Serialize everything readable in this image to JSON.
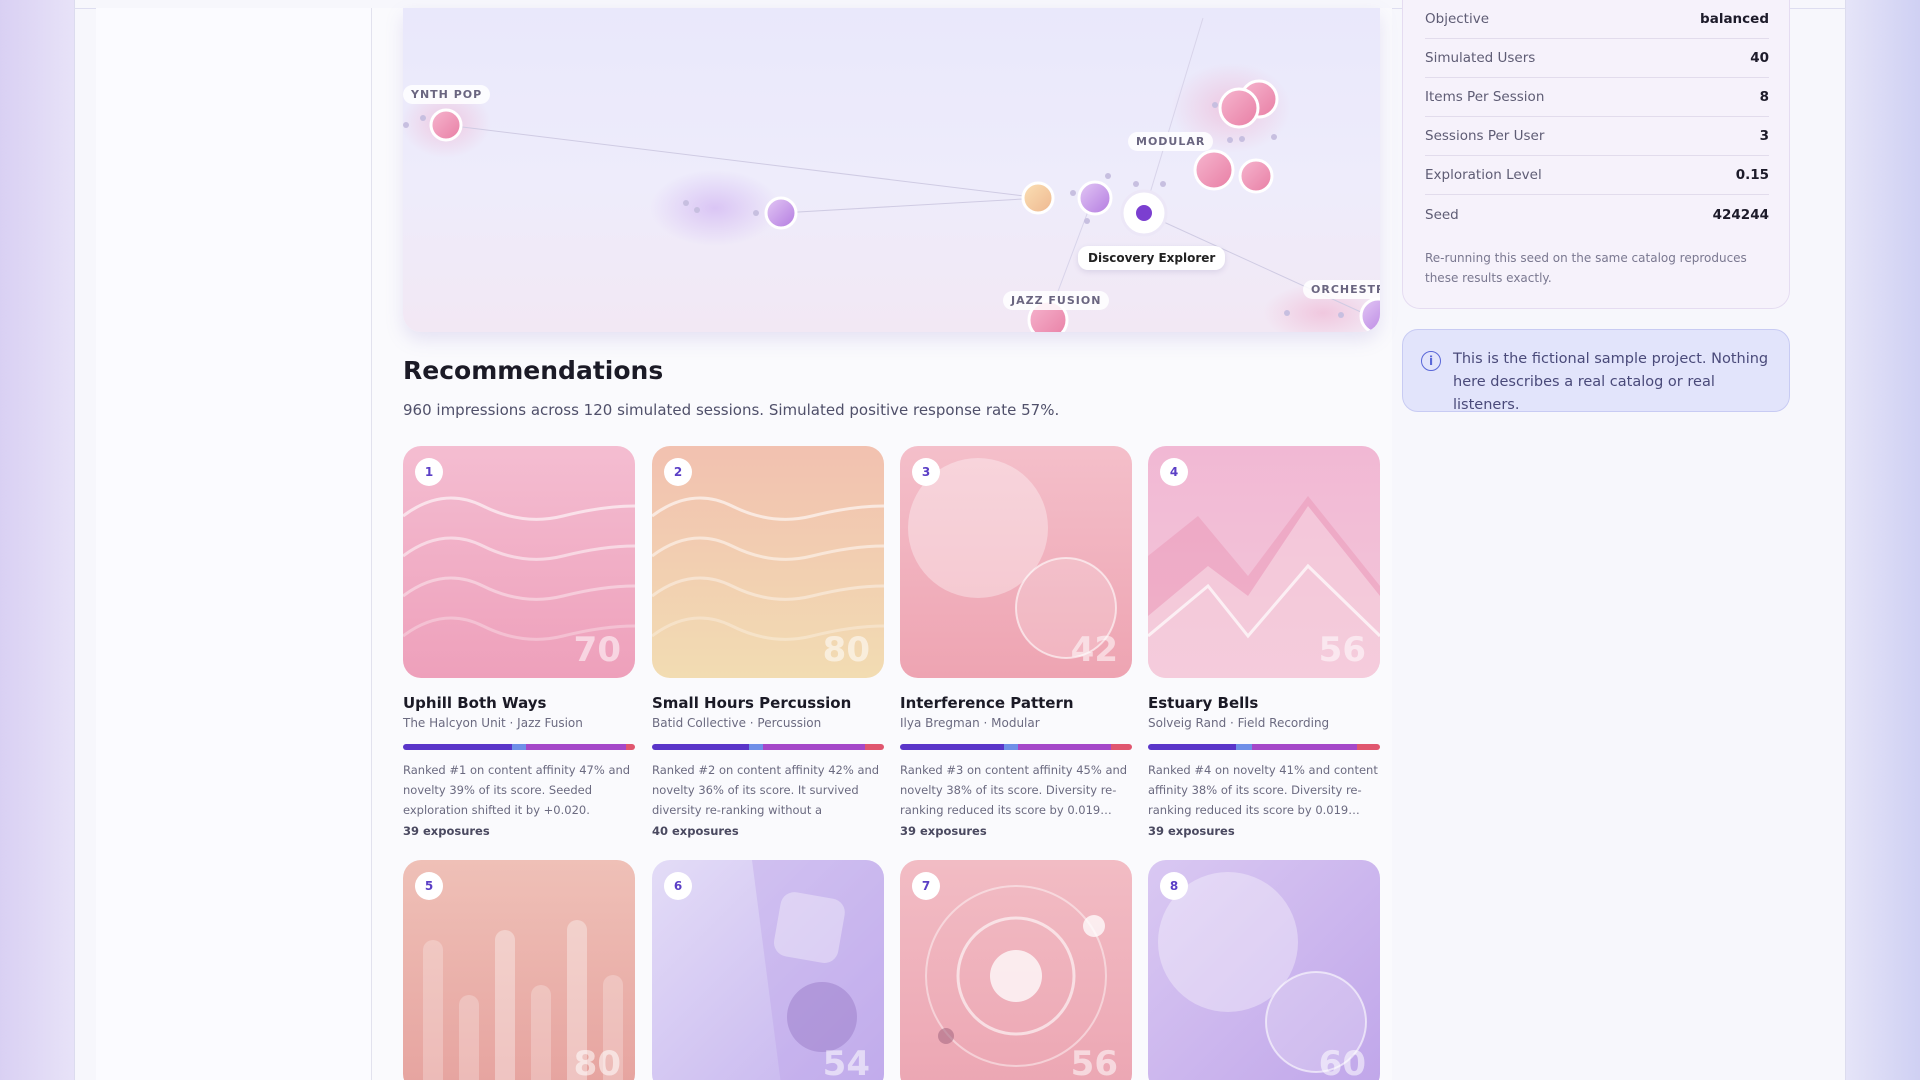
{
  "map": {
    "labels": {
      "synth_pop": "YNTH POP",
      "modular": "MODULAR",
      "jazz_fusion": "JAZZ FUSION",
      "orchestral": "ORCHESTRA"
    },
    "tooltip": "Discovery Explorer"
  },
  "recommendations": {
    "title": "Recommendations",
    "subtitle": "960 impressions across 120 simulated sessions. Simulated positive response rate 57%.",
    "cards": [
      {
        "rank": "1",
        "score": "70",
        "title": "Uphill Both Ways",
        "meta": "The Halcyon Unit · Jazz Fusion",
        "desc": "Ranked #1 on content affinity 47% and novelty 39% of its score. Seeded exploration shifted it by +0.020.",
        "exposures": "39 exposures",
        "art": "waves-pink",
        "breakdown": [
          0.47,
          0.06,
          0.43,
          0.04
        ]
      },
      {
        "rank": "2",
        "score": "80",
        "title": "Small Hours Percussion",
        "meta": "Batid Collective · Percussion",
        "desc": "Ranked #2 on content affinity 42% and novelty 36% of its score. It survived diversity re-ranking without a similarity…",
        "exposures": "40 exposures",
        "art": "waves-peach",
        "breakdown": [
          0.42,
          0.06,
          0.44,
          0.08
        ]
      },
      {
        "rank": "3",
        "score": "42",
        "title": "Interference Pattern",
        "meta": "Ilya Bregman · Modular",
        "desc": "Ranked #3 on content affinity 45% and novelty 38% of its score. Diversity re-ranking reduced its score by 0.019…",
        "exposures": "39 exposures",
        "art": "circles-pink",
        "breakdown": [
          0.45,
          0.06,
          0.4,
          0.09
        ]
      },
      {
        "rank": "4",
        "score": "56",
        "title": "Estuary Bells",
        "meta": "Solveig Rand · Field Recording",
        "desc": "Ranked #4 on novelty 41% and content affinity 38% of its score. Diversity re-ranking reduced its score by 0.019…",
        "exposures": "39 exposures",
        "art": "mountains-pink",
        "breakdown": [
          0.38,
          0.07,
          0.45,
          0.1
        ]
      },
      {
        "rank": "5",
        "score": "80",
        "art": "bars-peach"
      },
      {
        "rank": "6",
        "score": "54",
        "art": "shapes-lavender"
      },
      {
        "rank": "7",
        "score": "56",
        "art": "orbit-pink"
      },
      {
        "rank": "8",
        "score": "60",
        "art": "circles-lavender"
      }
    ]
  },
  "settings": {
    "rows": [
      {
        "label": "Objective",
        "value": "balanced"
      },
      {
        "label": "Simulated Users",
        "value": "40"
      },
      {
        "label": "Items Per Session",
        "value": "8"
      },
      {
        "label": "Sessions Per User",
        "value": "3"
      },
      {
        "label": "Exploration Level",
        "value": "0.15"
      },
      {
        "label": "Seed",
        "value": "424244"
      }
    ],
    "note": "Re-running this seed on the same catalog reproduces these results exactly."
  },
  "info": {
    "icon": "info-icon",
    "text": "This is the fictional sample project. Nothing here describes a real catalog or real listeners."
  },
  "colors": {
    "affinity": "#5a35c9",
    "exploration": "#6f8fe8",
    "novelty": "#a548c9",
    "diversity": "#e0566f",
    "accent": "#7b3fd0"
  }
}
